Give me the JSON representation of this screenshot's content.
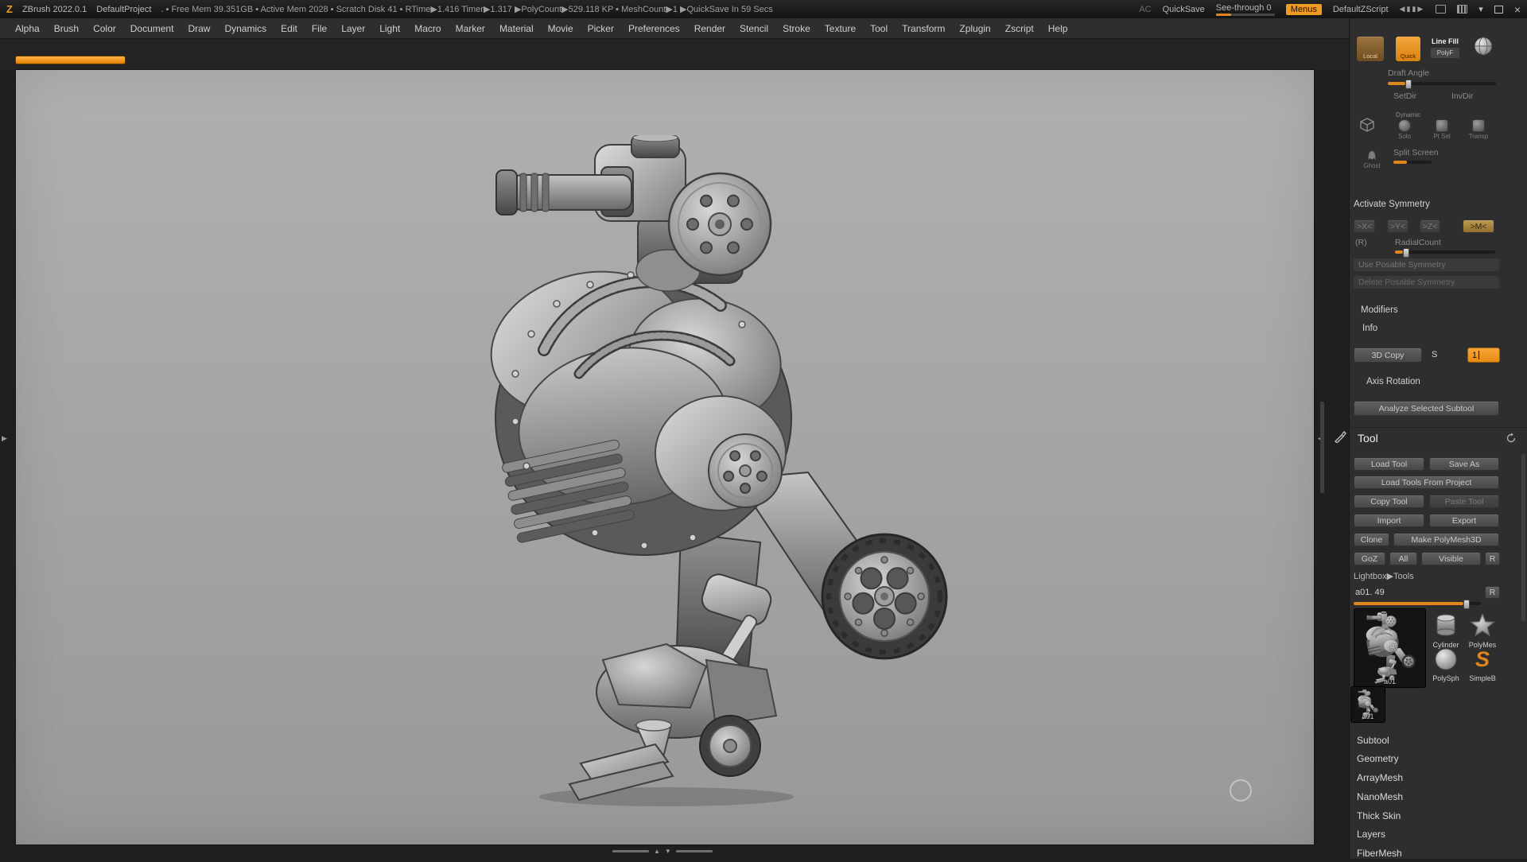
{
  "titlebar": {
    "app": "ZBrush 2022.0.1",
    "project": "DefaultProject",
    "stats": ". ▪ Free Mem 39.351GB ▪ Active Mem 2028 ▪ Scratch Disk 41 ▪ RTime▶1.416 Timer▶1.317 ▶PolyCount▶529.118 KP ▪ MeshCount▶1 ▶QuickSave In 59 Secs",
    "ac": "AC",
    "quicksave": "QuickSave",
    "see_through": "See-through",
    "see_through_value": "0",
    "menus": "Menus",
    "zscript": "DefaultZScript"
  },
  "menubar": {
    "items": [
      "Alpha",
      "Brush",
      "Color",
      "Document",
      "Draw",
      "Dynamics",
      "Edit",
      "File",
      "Layer",
      "Light",
      "Macro",
      "Marker",
      "Material",
      "Movie",
      "Picker",
      "Preferences",
      "Render",
      "Stencil",
      "Stroke",
      "Texture",
      "Tool",
      "Transform",
      "Zplugin",
      "Zscript",
      "Help"
    ]
  },
  "draw_controls": {
    "local": "Local",
    "quick": "Quick",
    "line_fill": "Line Fill",
    "polyf": "PolyF",
    "draft_angle": "Draft Angle",
    "setdir": "SetDir",
    "invdir": "InvDir",
    "dynamic": "Dynamic",
    "solo": "Solo",
    "pt_sel": "Pt Sel",
    "transp": "Transp",
    "split_screen": "Split Screen",
    "ghost": "Ghost"
  },
  "symmetry": {
    "header": "Activate Symmetry",
    "x": ">X<",
    "y": ">Y<",
    "z": ">Z<",
    "m": ">M<",
    "r": "(R)",
    "radial_count": "RadialCount",
    "use_posable": "Use Posable Symmetry",
    "delete_posable": "Delete Posable Symmetry"
  },
  "transform_info": {
    "modifiers": "Modifiers",
    "info": "Info",
    "copy_3d": "3D Copy",
    "s": "S",
    "s_value": "1",
    "axis_rotation": "Axis Rotation",
    "analyze": "Analyze Selected Subtool"
  },
  "tool_palette": {
    "header": "Tool",
    "load_tool": "Load Tool",
    "save_as": "Save As",
    "load_tools_from_project": "Load Tools From Project",
    "copy_tool": "Copy Tool",
    "paste_tool": "Paste Tool",
    "import": "Import",
    "export": "Export",
    "clone": "Clone",
    "make_polymesh3d": "Make PolyMesh3D",
    "goz": "GoZ",
    "all": "All",
    "visible": "Visible",
    "r": "R",
    "lightbox": "Lightbox▶Tools",
    "slider_label": "a01. 49",
    "thumbnails": {
      "a01": "a01",
      "cylinder": "Cylinder",
      "polymes": "PolyMes",
      "polysph": "PolySph",
      "simpleb": "SimpleB",
      "a01_small": "a01"
    }
  },
  "palette_sections": [
    "Subtool",
    "Geometry",
    "ArrayMesh",
    "NanoMesh",
    "Thick Skin",
    "Layers",
    "FiberMesh"
  ]
}
